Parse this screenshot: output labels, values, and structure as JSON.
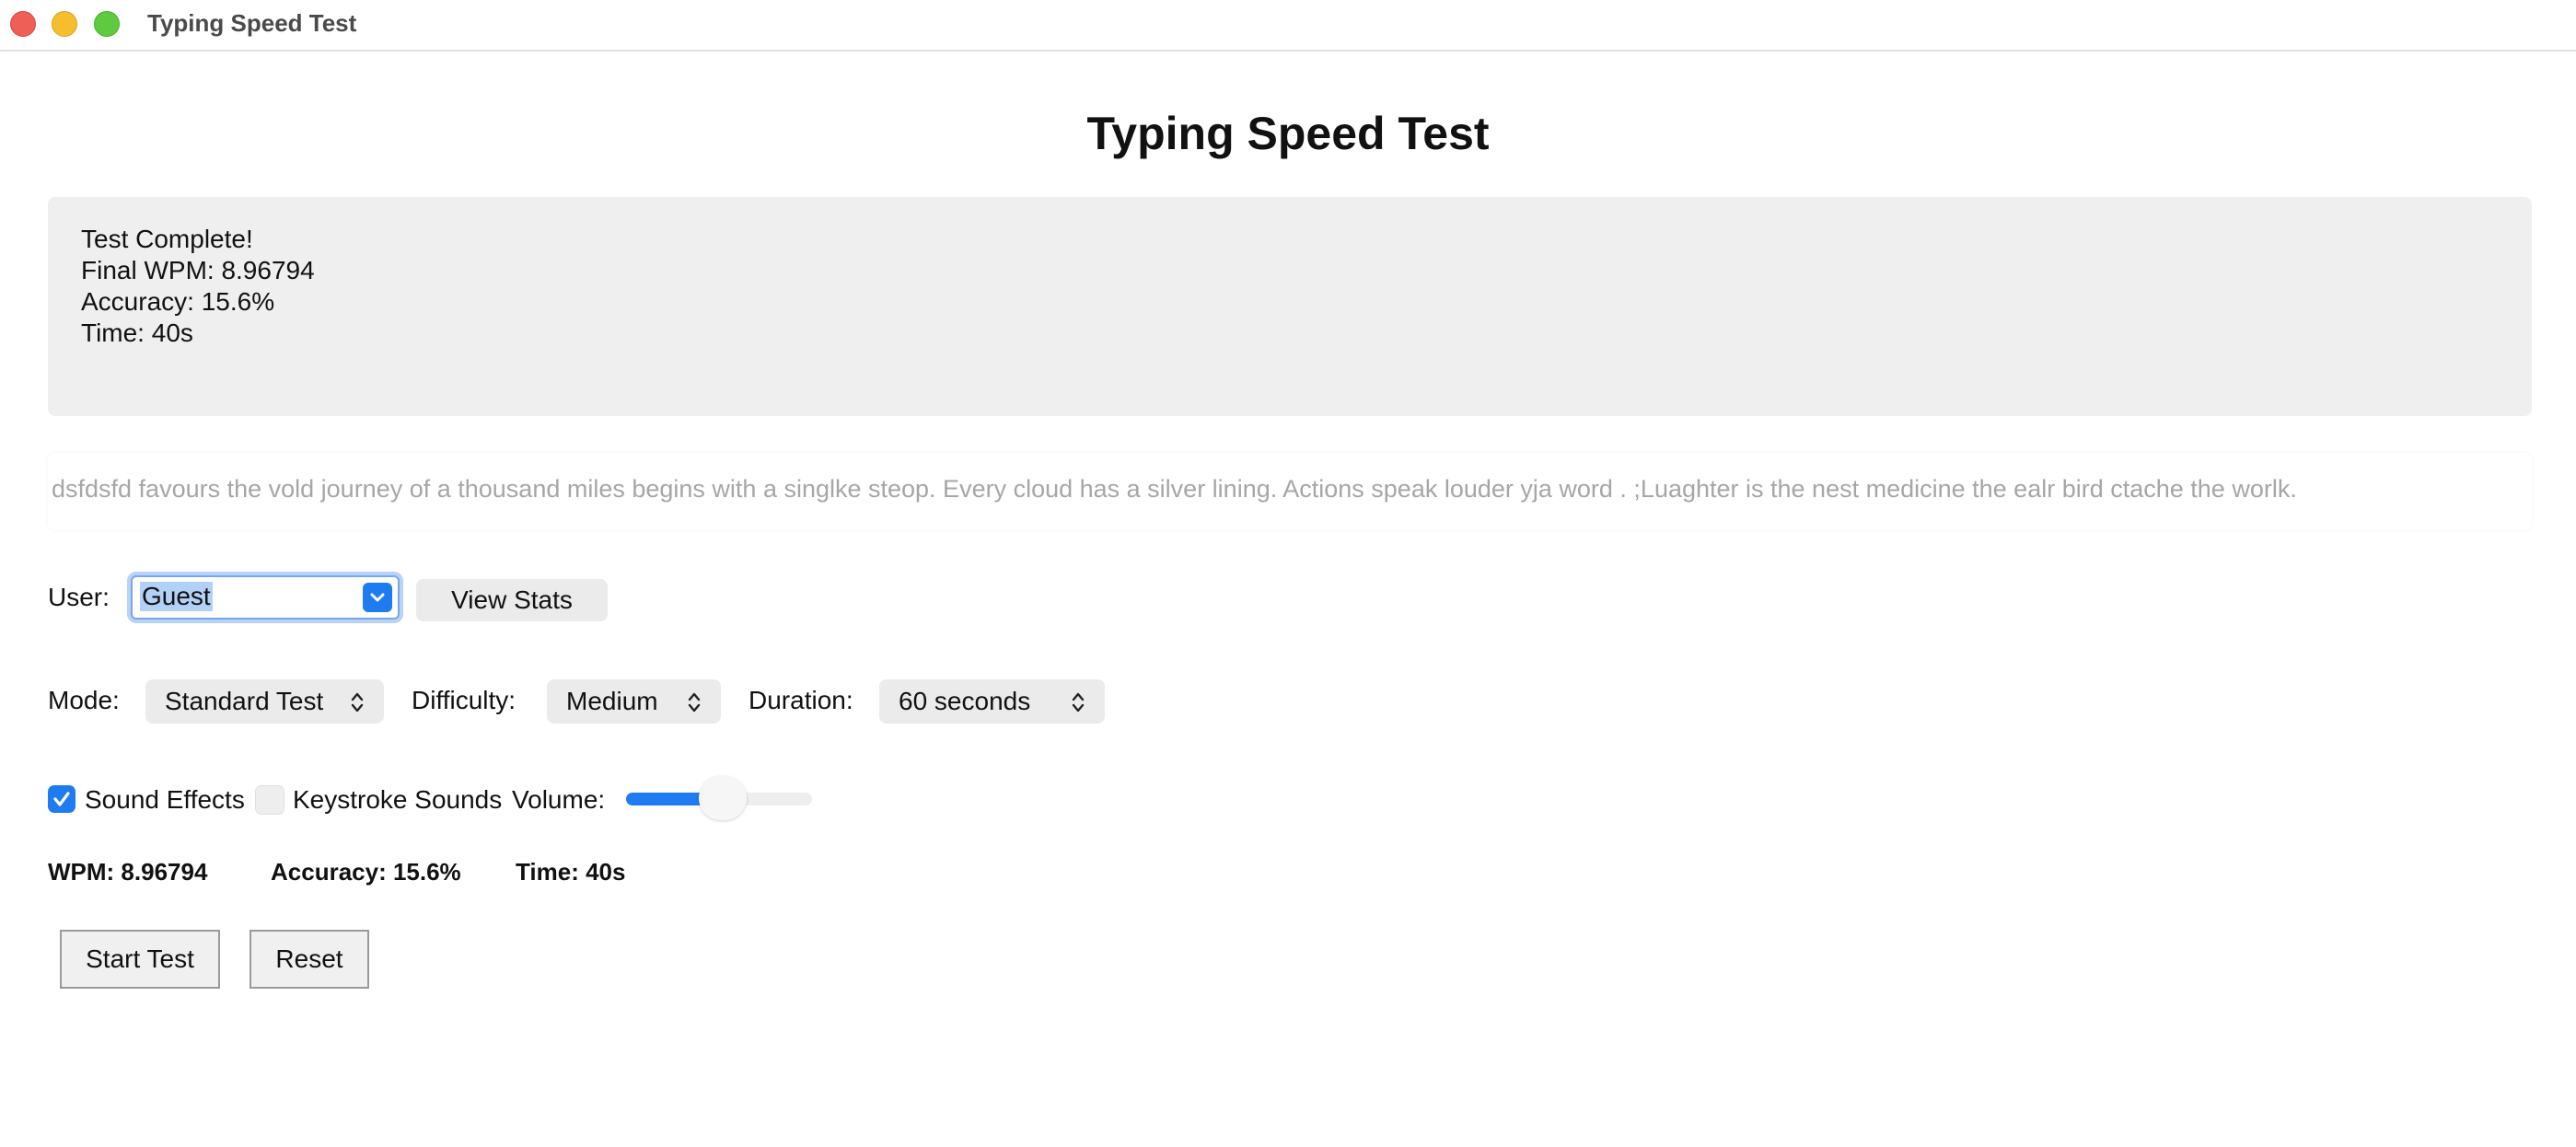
{
  "window": {
    "title": "Typing Speed Test"
  },
  "header": {
    "title": "Typing Speed Test"
  },
  "results": {
    "line1": "Test Complete!",
    "line2": "Final WPM: 8.96794",
    "line3": "Accuracy: 15.6%",
    "line4": "Time: 40s"
  },
  "passage": {
    "text": "dsfdsfd favours the vold journey of a thousand  miles begins with a singlke steop. Every cloud has a silver lining. Actions speak louder yja word . ;Luaghter is the  nest medicine the ealr bird ctache the worlk."
  },
  "user": {
    "label": "User:",
    "selected": "Guest",
    "view_stats_label": "View Stats"
  },
  "settings": {
    "mode_label": "Mode:",
    "mode_value": "Standard Test",
    "difficulty_label": "Difficulty:",
    "difficulty_value": "Medium",
    "duration_label": "Duration:",
    "duration_value": "60 seconds"
  },
  "sound": {
    "sound_effects_label": "Sound Effects",
    "sound_effects_checked": true,
    "keystroke_label": "Keystroke Sounds",
    "keystroke_checked": false,
    "volume_label": "Volume:",
    "volume_fraction": 0.45
  },
  "stats": {
    "wpm": "WPM: 8.96794",
    "accuracy": "Accuracy: 15.6%",
    "time": "Time: 40s"
  },
  "actions": {
    "start_label": "Start Test",
    "reset_label": "Reset"
  },
  "colors": {
    "accent": "#1f7cf0",
    "panel": "#efefef",
    "passage_text": "#a6a6a6"
  },
  "icons": {
    "close": "window-close-icon",
    "minimize": "window-minimize-icon",
    "maximize": "window-maximize-icon",
    "dropdown": "chevron-down-icon",
    "updown": "updown-chevron-icon",
    "check": "checkmark-icon"
  }
}
